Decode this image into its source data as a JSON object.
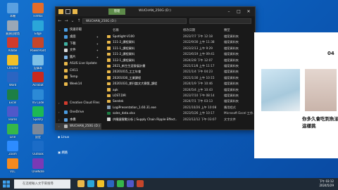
{
  "window": {
    "manage_tab": "管理",
    "title": "WUCHAN_250G (D:)",
    "path": "WUCHAN_250G (D:)"
  },
  "columns": {
    "name": "名稱",
    "date": "修改日期",
    "type": "類型"
  },
  "nav": {
    "quick_access": "快速存取",
    "items": [
      {
        "label": "桌面",
        "pinned": true
      },
      {
        "label": "下載",
        "pinned": true
      },
      {
        "label": "文件",
        "pinned": true
      },
      {
        "label": "圖片",
        "pinned": true
      },
      {
        "label": "ASUS Live Update",
        "pinned": false
      },
      {
        "label": "CH11",
        "pinned": false
      },
      {
        "label": "Temp",
        "pinned": false
      },
      {
        "label": "Week14",
        "pinned": false
      }
    ],
    "creative_cloud": "Creative Cloud Files",
    "onedrive": "OneDrive",
    "this_pc": "本機",
    "drive": "WUCHAN_250G (D:)",
    "linux": "Linux",
    "network": "網路"
  },
  "files": [
    {
      "name": "Spotlight-V100",
      "date": "2023/7/7 下午 12:18",
      "type": "檔案資料夾"
    },
    {
      "name": "111-2_課程資料",
      "date": "2022/9/30 上午 11:38",
      "type": "檔案資料夾"
    },
    {
      "name": "111-1_課程資料",
      "date": "2023/2/13 上午 9:29",
      "type": "檔案資料夾"
    },
    {
      "name": "111-2_課程資料",
      "date": "2023/6/19 上午 09:41",
      "type": "檔案資料夾"
    },
    {
      "name": "112-1_課程資料",
      "date": "2024/2/8 下午 12:07",
      "type": "檔案資料夾"
    },
    {
      "name": "2021_新生生涯發展計畫",
      "date": "2021/11/8 上午 11:17",
      "type": "檔案資料夾"
    },
    {
      "name": "20201015_工工年會",
      "date": "2021/1/4 下午 04:23",
      "type": "檔案資料夾"
    },
    {
      "name": "20201030_工業課程",
      "date": "2021/1/30 上午 10:15",
      "type": "檔案資料夾"
    },
    {
      "name": "20201031_期刊論文大賽第_課程",
      "date": "2024/1/9 下午 10:46",
      "type": "檔案資料夾"
    },
    {
      "name": "apk",
      "date": "2024/5/4 上午 10:43",
      "type": "檔案資料夾"
    },
    {
      "name": "LOST.DIR",
      "date": "2023/7/10 下午 08:14",
      "type": "檔案資料夾"
    },
    {
      "name": "Seedek",
      "date": "2024/7/1 下午 03:13",
      "type": "檔案資料夾"
    },
    {
      "name": "LogiPresentation_1.60.31.exe",
      "date": "2021/10/26 上午 10:08",
      "type": "應用程式"
    },
    {
      "name": "sales_data.xlsx",
      "date": "2023/5/26 上午 10:17",
      "type": "Microsoft Excel 工作..."
    },
    {
      "name": "供應鏈實戰分析 | Supply Chain Ripple Effect...",
      "date": "2023/12/12 下午 03:07",
      "type": "文字文件"
    }
  ],
  "desktop_icons": [
    {
      "label": "本機",
      "color": "#5aa0e0"
    },
    {
      "label": "資源回收筒",
      "color": "#9aa7b6"
    },
    {
      "label": "Adobe",
      "color": "#d23b2d"
    },
    {
      "label": "Chrome",
      "color": "#f2c029"
    },
    {
      "label": "Word",
      "color": "#2b65c2"
    },
    {
      "label": "Excel",
      "color": "#1d7f44"
    },
    {
      "label": "Teams",
      "color": "#5058c9"
    },
    {
      "label": "Line",
      "color": "#36b74a"
    },
    {
      "label": "Zoom",
      "color": "#2d8cff"
    },
    {
      "label": "VLC",
      "color": "#f58a1f"
    },
    {
      "label": "Firefox",
      "color": "#e56c2b"
    },
    {
      "label": "Edge",
      "color": "#2aa6d9"
    },
    {
      "label": "PowerPoint",
      "color": "#c5462b"
    },
    {
      "label": "記事本",
      "color": "#7ec0e6"
    },
    {
      "label": "Acrobat",
      "color": "#c9291f"
    },
    {
      "label": "VS Code",
      "color": "#2c8ad6"
    },
    {
      "label": "Spotify",
      "color": "#1db954"
    },
    {
      "label": "設定",
      "color": "#7c8899"
    },
    {
      "label": "Outlook",
      "color": "#1b6cc7"
    },
    {
      "label": "OneNote",
      "color": "#7a3ab5"
    }
  ],
  "right_window": {
    "number": "04",
    "ad_text": "你多久會吃到魚油這樣挑"
  },
  "taskbar": {
    "search_placeholder": "在這裡輸入文字來搜尋",
    "time": "下午 03:12",
    "date": "2024/5/29"
  }
}
